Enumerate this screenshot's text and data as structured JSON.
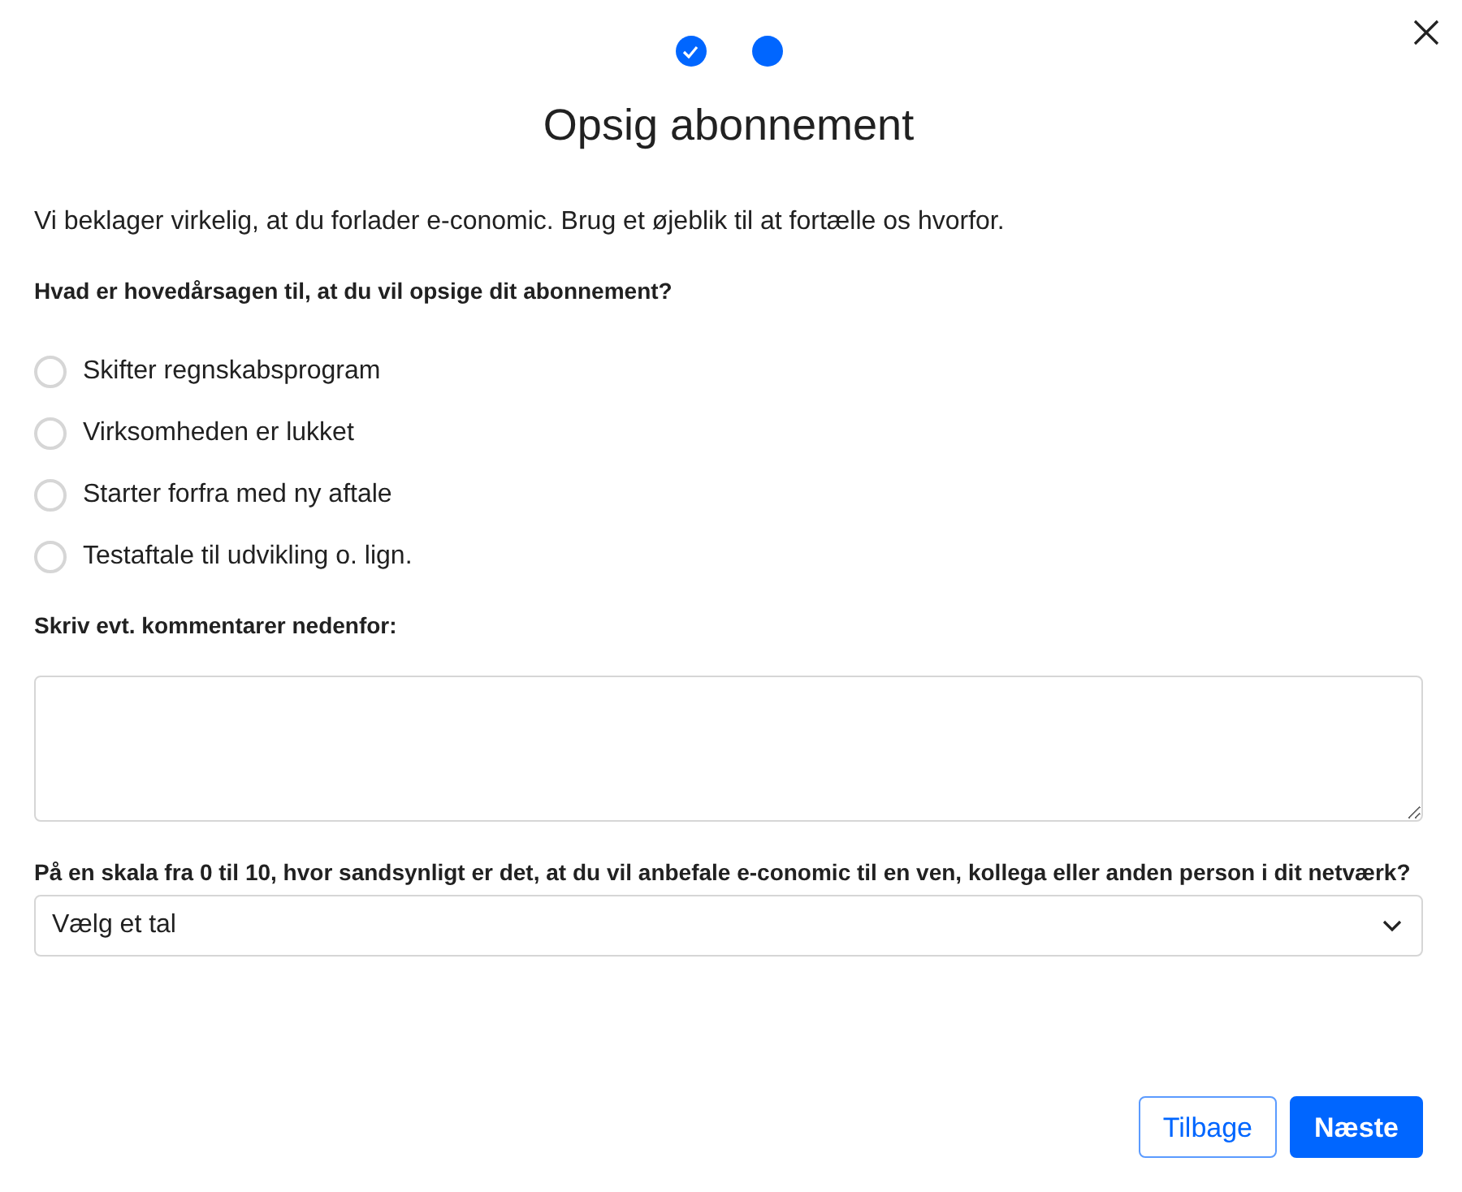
{
  "steps": [
    {
      "kind": "done"
    },
    {
      "kind": "current"
    }
  ],
  "title": "Opsig abonnement",
  "intro": "Vi beklager virkelig, at du forlader e-conomic. Brug et øjeblik til at fortælle os hvorfor.",
  "reason_question": "Hvad er hovedårsagen til, at du vil opsige dit abonnement?",
  "reasons": [
    {
      "label": "Skifter regnskabsprogram",
      "selected": false
    },
    {
      "label": "Virksomheden er lukket",
      "selected": false
    },
    {
      "label": "Starter forfra med ny aftale",
      "selected": false
    },
    {
      "label": "Testaftale til udvikling o. lign.",
      "selected": false
    }
  ],
  "comment_label": "Skriv evt. kommentarer nedenfor:",
  "rating_question": "På en skala fra 0 til 10, hvor sandsynligt er det, at du vil anbefale e-conomic til en ven, kollega eller anden person i dit netværk?",
  "rating_select": {
    "value": "Vælg et tal"
  },
  "buttons": [
    {
      "label": "Tilbage",
      "kind": "secondary"
    },
    {
      "label": "Næste",
      "kind": "primary"
    }
  ]
}
